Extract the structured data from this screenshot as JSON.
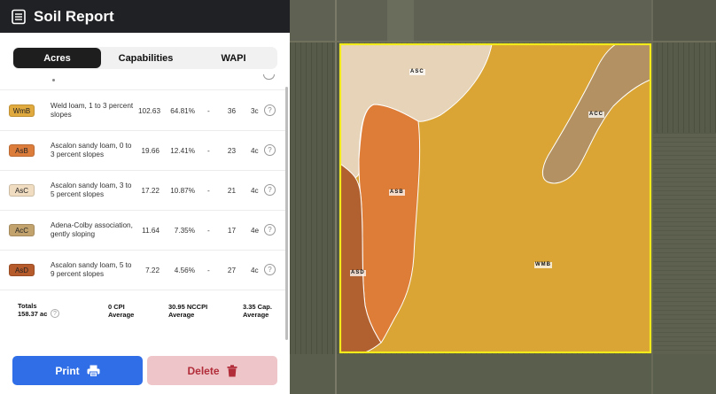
{
  "header": {
    "title": "Soil Report",
    "icon": "document-icon"
  },
  "tabs": [
    {
      "label": "Acres",
      "active": true
    },
    {
      "label": "Capabilities",
      "active": false
    },
    {
      "label": "WAPI",
      "active": false
    }
  ],
  "soils": [
    {
      "code": "WmB",
      "color": "#e1aa3e",
      "description": "Weld loam, 1 to 3 percent slopes",
      "acres": "102.63",
      "percent": "64.81%",
      "cpi": "-",
      "nccpi": "36",
      "capability": "3c"
    },
    {
      "code": "AsB",
      "color": "#dd7d3c",
      "description": "Ascalon sandy loam, 0 to 3 percent slopes",
      "acres": "19.66",
      "percent": "12.41%",
      "cpi": "-",
      "nccpi": "23",
      "capability": "4c"
    },
    {
      "code": "AsC",
      "color": "#f0dcc0",
      "description": "Ascalon sandy loam, 3 to 5 percent slopes",
      "acres": "17.22",
      "percent": "10.87%",
      "cpi": "-",
      "nccpi": "21",
      "capability": "4c"
    },
    {
      "code": "AcC",
      "color": "#c2a36e",
      "description": "Adena-Colby association, gently sloping",
      "acres": "11.64",
      "percent": "7.35%",
      "cpi": "-",
      "nccpi": "17",
      "capability": "4e"
    },
    {
      "code": "AsD",
      "color": "#b65b2b",
      "description": "Ascalon sandy loam, 5 to 9 percent slopes",
      "acres": "7.22",
      "percent": "4.56%",
      "cpi": "-",
      "nccpi": "27",
      "capability": "4c"
    }
  ],
  "help_symbol": "?",
  "totals": {
    "label": "Totals",
    "acres": "158.37 ac",
    "cpi_value": "0 CPI",
    "cpi_sub": "Average",
    "nccpi_value": "30.95 NCCPI",
    "nccpi_sub": "Average",
    "cap_value": "3.35 Cap.",
    "cap_sub": "Average"
  },
  "buttons": {
    "print": "Print",
    "delete": "Delete"
  },
  "map": {
    "labels": {
      "asc": "ASC",
      "acc": "ACC",
      "asb": "ASB",
      "asd": "ASD",
      "wmb": "WMB"
    },
    "boundary_color": "#f2ea1a"
  }
}
